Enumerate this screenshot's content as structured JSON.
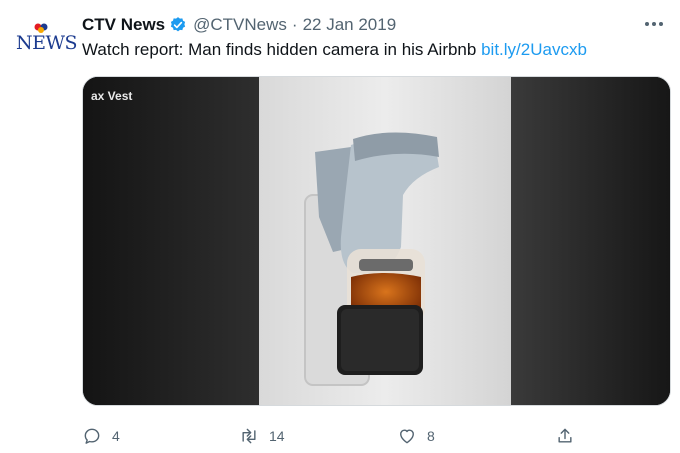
{
  "tweet": {
    "author_name": "CTV News",
    "handle": "@CTVNews",
    "separator": "·",
    "date": "22 Jan 2019",
    "avatar_wordmark": "NEWS",
    "text": "Watch report: Man finds hidden camera in his Airbnb",
    "link_text": "bit.ly/2Uavcxb",
    "media_overlay_text": "ax Vest",
    "counts": {
      "replies": "4",
      "retweets": "14",
      "likes": "8"
    },
    "icons": {
      "verified": "verified-badge-icon",
      "more": "more-options-icon",
      "reply": "reply-icon",
      "retweet": "retweet-icon",
      "like": "heart-icon",
      "share": "share-icon"
    },
    "colors": {
      "link": "#1d9bf0",
      "verified": "#1d9bf0",
      "secondary_text": "#536471",
      "brand_blue": "#1c3b8f"
    }
  }
}
